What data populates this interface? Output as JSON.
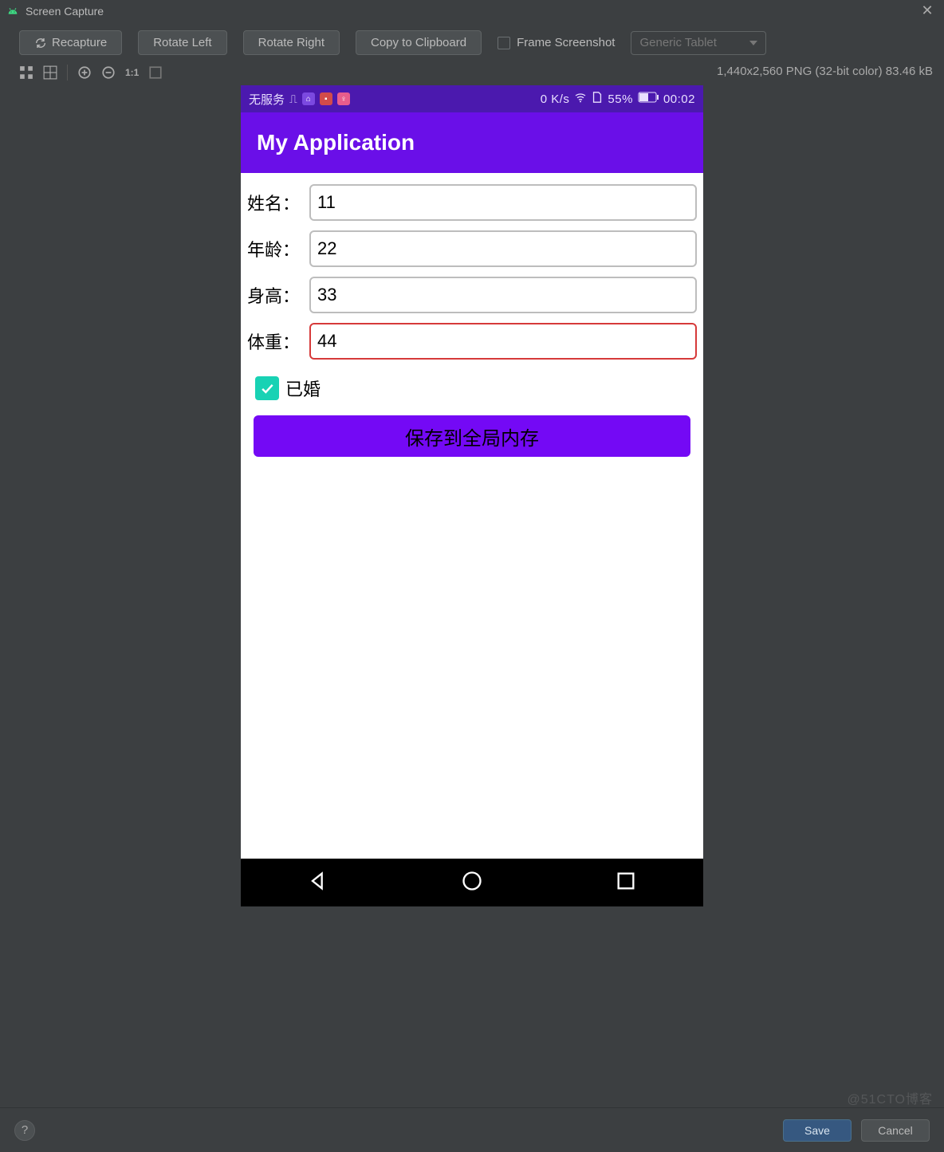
{
  "window": {
    "title": "Screen Capture"
  },
  "toolbar": {
    "recapture": "Recapture",
    "rotate_left": "Rotate Left",
    "rotate_right": "Rotate Right",
    "copy_clipboard": "Copy to Clipboard",
    "frame_screenshot": "Frame Screenshot",
    "device_dropdown": "Generic Tablet"
  },
  "iconrow": {
    "zoom_ratio": "1:1",
    "image_meta": "1,440x2,560 PNG (32-bit color) 83.46 kB"
  },
  "phone": {
    "statusbar": {
      "carrier": "无服务",
      "speed": "0 K/s",
      "battery": "55%",
      "time": "00:02"
    },
    "appbar_title": "My Application",
    "form": {
      "name_label": "姓名：",
      "name_value": "11",
      "age_label": "年龄：",
      "age_value": "22",
      "height_label": "身高：",
      "height_value": "33",
      "weight_label": "体重：",
      "weight_value": "44",
      "married_label": "已婚",
      "married_checked": true,
      "save_button": "保存到全局内存"
    }
  },
  "footer": {
    "save": "Save",
    "cancel": "Cancel"
  },
  "watermark": "@51CTO博客"
}
